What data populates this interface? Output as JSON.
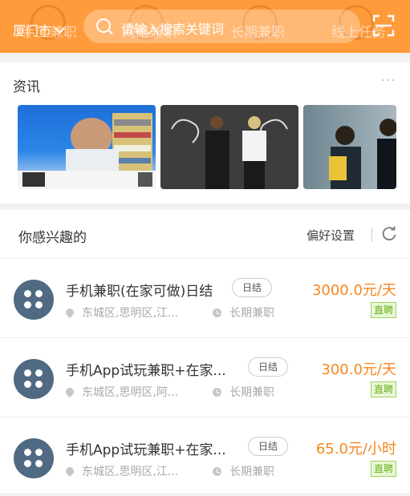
{
  "header": {
    "city": "厦门市",
    "search_placeholder": "请输入搜索关键词",
    "background_categories": [
      "手工兼职",
      "网络兼职",
      "长期兼职",
      "线上任务"
    ]
  },
  "news": {
    "title": "资讯",
    "more_label": "···",
    "thumbnails": [
      {
        "icon": "stressed-office-worker-photo"
      },
      {
        "icon": "business-couple-muscle-chalk-photo"
      },
      {
        "icon": "business-people-meeting-photo"
      }
    ]
  },
  "interest": {
    "title": "你感兴趣的",
    "preference_label": "偏好设置",
    "jobs": [
      {
        "title": "手机兼职(在家可做)日结",
        "tag": "日结",
        "location": "东城区,思明区,江...",
        "type": "长期兼职",
        "salary": "3000.0元/天",
        "badge": "直聘"
      },
      {
        "title": "手机App试玩兼职+在家...",
        "tag": "日结",
        "location": "东城区,思明区,阿...",
        "type": "长期兼职",
        "salary": "300.0元/天",
        "badge": "直聘"
      },
      {
        "title": "手机App试玩兼职+在家...",
        "tag": "日结",
        "location": "东城区,思明区,江...",
        "type": "长期兼职",
        "salary": "65.0元/小时",
        "badge": "直聘"
      }
    ]
  },
  "colors": {
    "brand": "#ff9b3a",
    "salary": "#f5871f",
    "avatar": "#4f6a82",
    "badge_green": "#66b21b"
  }
}
